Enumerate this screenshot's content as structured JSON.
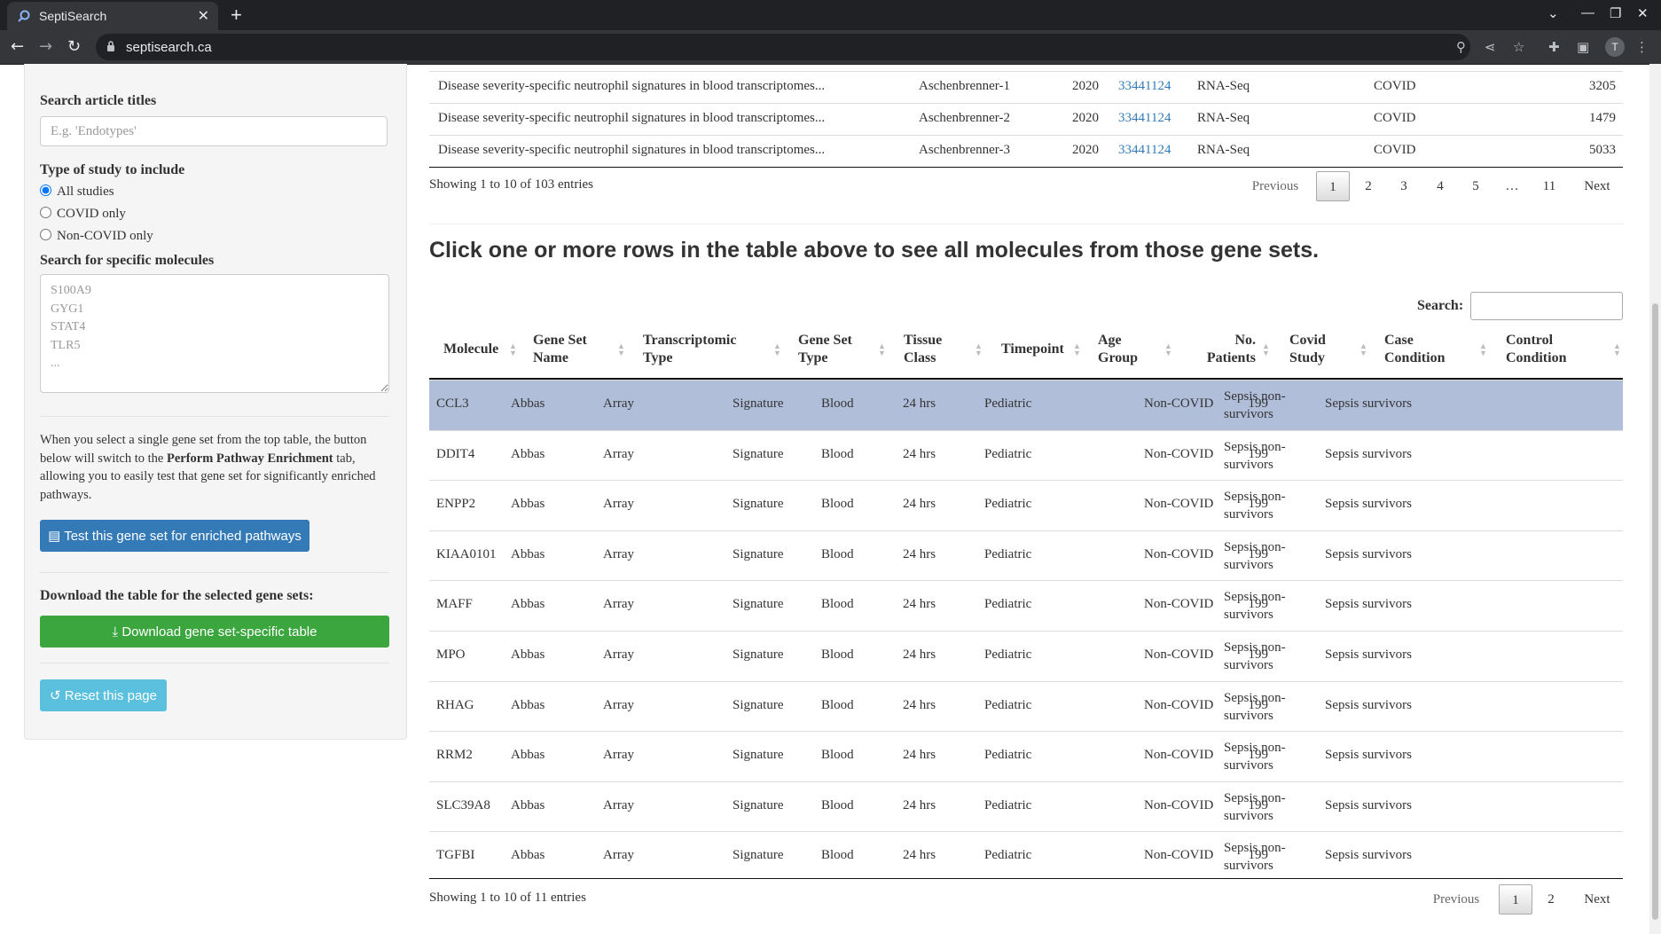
{
  "browser": {
    "tab_title": "SeptiSearch",
    "tab_close": "✕",
    "new_tab": "+",
    "url": "septisearch.ca",
    "avatar_letter": "T"
  },
  "sidebar": {
    "search_titles_label": "Search article titles",
    "search_titles_placeholder": "E.g. 'Endotypes'",
    "study_type_label": "Type of study to include",
    "study_options": [
      "All studies",
      "COVID only",
      "Non-COVID only"
    ],
    "selected_study_option": "All studies",
    "molecules_label": "Search for specific molecules",
    "molecules_placeholder": "S100A9\nGYG1\nSTAT4\nTLR5\n...",
    "para_prefix": "When you select a single gene set from the top table, the button below will switch to the ",
    "para_bold": "Perform Pathway Enrichment",
    "para_suffix": " tab, allowing you to easily test that gene set for significantly enriched pathways.",
    "test_button": "Test this gene set for enriched pathways",
    "download_label": "Download the table for the selected gene sets:",
    "download_button": "Download gene set-specific table",
    "reset_button": "Reset this page"
  },
  "top_table": {
    "rows": [
      {
        "title": "Disease severity-specific neutrophil signatures in blood transcriptomes...",
        "gene_set": "Aschenbrenner-1",
        "year": "2020",
        "pmid": "33441124",
        "type": "RNA-Seq",
        "covid": "COVID",
        "count": "3205"
      },
      {
        "title": "Disease severity-specific neutrophil signatures in blood transcriptomes...",
        "gene_set": "Aschenbrenner-2",
        "year": "2020",
        "pmid": "33441124",
        "type": "RNA-Seq",
        "covid": "COVID",
        "count": "1479"
      },
      {
        "title": "Disease severity-specific neutrophil signatures in blood transcriptomes...",
        "gene_set": "Aschenbrenner-3",
        "year": "2020",
        "pmid": "33441124",
        "type": "RNA-Seq",
        "covid": "COVID",
        "count": "5033"
      }
    ],
    "info": "Showing 1 to 10 of 103 entries",
    "pager": {
      "previous": "Previous",
      "pages": [
        "1",
        "2",
        "3",
        "4",
        "5",
        "…",
        "11"
      ],
      "current": "1",
      "next": "Next"
    }
  },
  "heading": "Click one or more rows in the table above to see all molecules from those gene sets.",
  "bottom_table": {
    "search_label": "Search:",
    "columns": [
      "Molecule",
      "Gene Set Name",
      "Transcriptomic Type",
      "Gene Set Type",
      "Tissue Class",
      "Timepoint",
      "Age Group",
      "No. Patients",
      "Covid Study",
      "Case Condition",
      "Control Condition"
    ],
    "columns_display": [
      [
        "Molecule"
      ],
      [
        "Gene Set",
        "Name"
      ],
      [
        "Transcriptomic",
        "Type"
      ],
      [
        "Gene Set",
        "Type"
      ],
      [
        "Tissue",
        "Class"
      ],
      [
        "Timepoint"
      ],
      [
        "Age",
        "Group"
      ],
      [
        "No.",
        "Patients"
      ],
      [
        "Covid",
        "Study"
      ],
      [
        "Case",
        "Condition"
      ],
      [
        "Control",
        "Condition"
      ]
    ],
    "rows": [
      [
        "CCL3",
        "Abbas",
        "Array",
        "Signature",
        "Blood",
        "24 hrs",
        "Pediatric",
        "199",
        "Non-COVID",
        "Sepsis non-survivors",
        "Sepsis survivors"
      ],
      [
        "DDIT4",
        "Abbas",
        "Array",
        "Signature",
        "Blood",
        "24 hrs",
        "Pediatric",
        "199",
        "Non-COVID",
        "Sepsis non-survivors",
        "Sepsis survivors"
      ],
      [
        "ENPP2",
        "Abbas",
        "Array",
        "Signature",
        "Blood",
        "24 hrs",
        "Pediatric",
        "199",
        "Non-COVID",
        "Sepsis non-survivors",
        "Sepsis survivors"
      ],
      [
        "KIAA0101",
        "Abbas",
        "Array",
        "Signature",
        "Blood",
        "24 hrs",
        "Pediatric",
        "199",
        "Non-COVID",
        "Sepsis non-survivors",
        "Sepsis survivors"
      ],
      [
        "MAFF",
        "Abbas",
        "Array",
        "Signature",
        "Blood",
        "24 hrs",
        "Pediatric",
        "199",
        "Non-COVID",
        "Sepsis non-survivors",
        "Sepsis survivors"
      ],
      [
        "MPO",
        "Abbas",
        "Array",
        "Signature",
        "Blood",
        "24 hrs",
        "Pediatric",
        "199",
        "Non-COVID",
        "Sepsis non-survivors",
        "Sepsis survivors"
      ],
      [
        "RHAG",
        "Abbas",
        "Array",
        "Signature",
        "Blood",
        "24 hrs",
        "Pediatric",
        "199",
        "Non-COVID",
        "Sepsis non-survivors",
        "Sepsis survivors"
      ],
      [
        "RRM2",
        "Abbas",
        "Array",
        "Signature",
        "Blood",
        "24 hrs",
        "Pediatric",
        "199",
        "Non-COVID",
        "Sepsis non-survivors",
        "Sepsis survivors"
      ],
      [
        "SLC39A8",
        "Abbas",
        "Array",
        "Signature",
        "Blood",
        "24 hrs",
        "Pediatric",
        "199",
        "Non-COVID",
        "Sepsis non-survivors",
        "Sepsis survivors"
      ],
      [
        "TGFBI",
        "Abbas",
        "Array",
        "Signature",
        "Blood",
        "24 hrs",
        "Pediatric",
        "199",
        "Non-COVID",
        "Sepsis non-survivors",
        "Sepsis survivors"
      ]
    ],
    "case_condition_lines": [
      "Sepsis non-",
      "survivors"
    ],
    "selected_row": "CCL3",
    "info": "Showing 1 to 10 of 11 entries",
    "pager": {
      "previous": "Previous",
      "pages": [
        "1",
        "2"
      ],
      "current": "1",
      "next": "Next"
    }
  },
  "colors": {
    "selected_row": "#b0bed9",
    "link": "#337ab7",
    "primary": "#337ab7",
    "success": "#3ba63e",
    "info": "#5bc0de"
  }
}
